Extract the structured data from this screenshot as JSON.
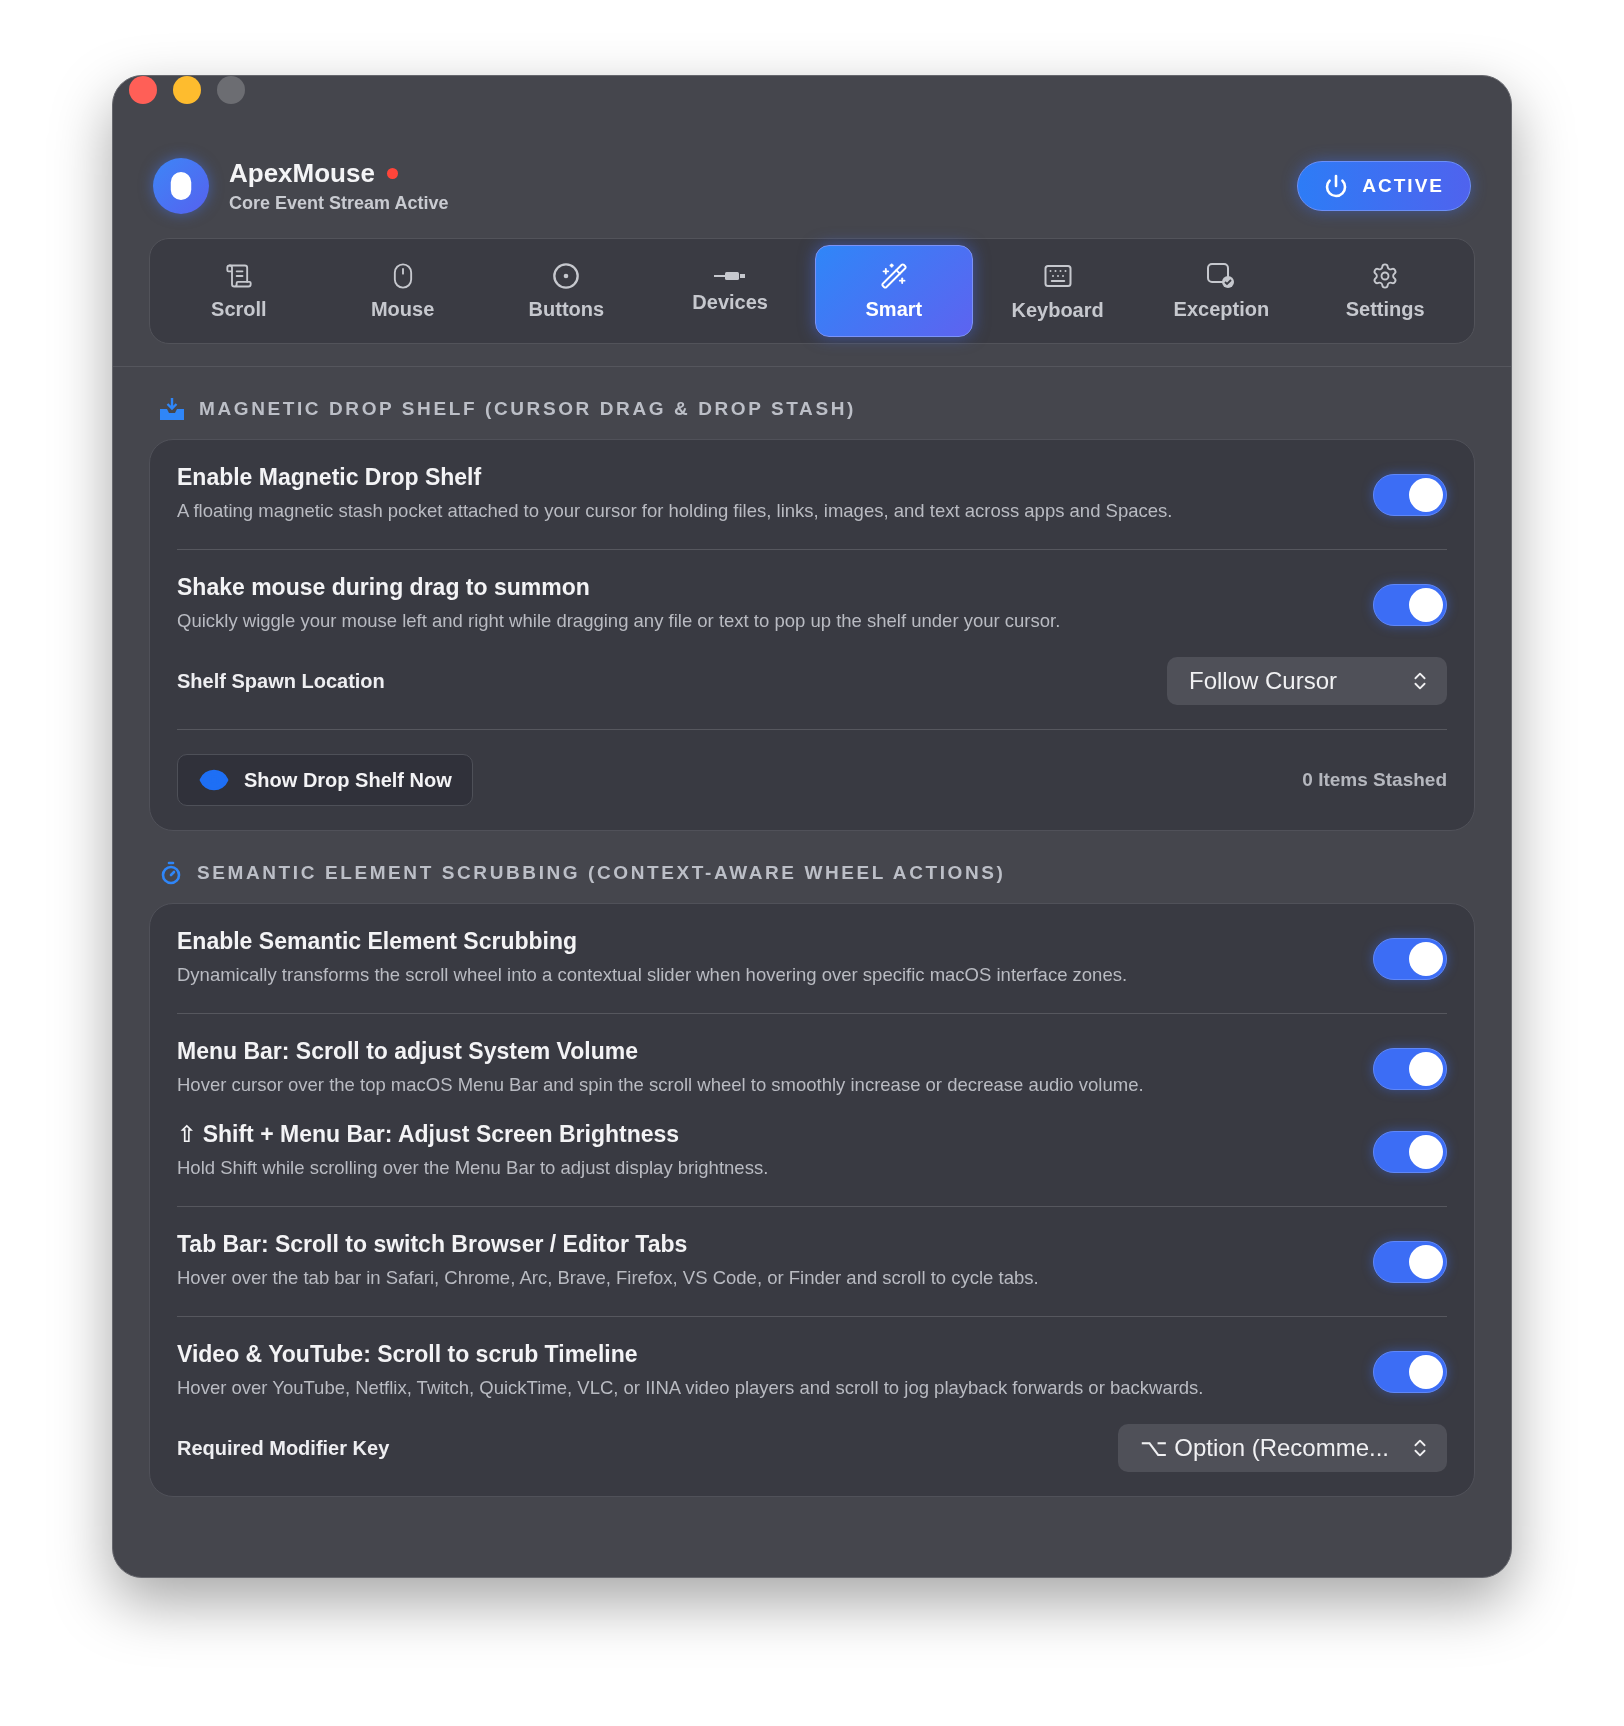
{
  "window": {
    "controls": [
      {
        "color": "#ff5f57"
      },
      {
        "color": "#febc2e"
      },
      {
        "color": "#6c6d72"
      }
    ]
  },
  "header": {
    "app_name": "ApexMouse",
    "status_dot": {
      "color": "#ff453a"
    },
    "subtitle": "Core Event Stream Active",
    "power_button": {
      "label": "ACTIVE"
    }
  },
  "tabs": [
    {
      "label": "Scroll",
      "selected": false
    },
    {
      "label": "Mouse",
      "selected": false
    },
    {
      "label": "Buttons",
      "selected": false
    },
    {
      "label": "Devices",
      "selected": false
    },
    {
      "label": "Smart",
      "selected": true
    },
    {
      "label": "Keyboard",
      "selected": false
    },
    {
      "label": "Exception",
      "selected": false
    },
    {
      "label": "Settings",
      "selected": false
    }
  ],
  "sections": [
    {
      "kind": "shelf",
      "title": "MAGNETIC DROP SHELF (CURSOR DRAG & DROP STASH)",
      "groups": [
        [
          {
            "kind": "toggle",
            "title": "Enable Magnetic Drop Shelf",
            "description": "A floating magnetic stash pocket attached to your cursor for holding files, links, images, and text across apps and Spaces.",
            "on": true
          }
        ],
        [
          {
            "kind": "toggle",
            "title": "Shake mouse during drag to summon",
            "description": "Quickly wiggle your mouse left and right while dragging any file or text to pop up the shelf under your cursor.",
            "on": true
          },
          {
            "kind": "select",
            "label": "Shelf Spawn Location",
            "value": "Follow Cursor"
          }
        ],
        [
          {
            "kind": "action",
            "button": "Show Drop Shelf Now",
            "count": "0 Items Stashed"
          }
        ]
      ]
    },
    {
      "kind": "scrub",
      "title": "SEMANTIC ELEMENT SCRUBBING (CONTEXT-AWARE WHEEL ACTIONS)",
      "groups": [
        [
          {
            "kind": "toggle",
            "title": "Enable Semantic Element Scrubbing",
            "description": "Dynamically transforms the scroll wheel into a contextual slider when hovering over specific macOS interface zones.",
            "on": true
          }
        ],
        [
          {
            "kind": "toggle",
            "title": "Menu Bar: Scroll to adjust System Volume",
            "description": "Hover cursor over the top macOS Menu Bar and spin the scroll wheel to smoothly increase or decrease audio volume.",
            "on": true
          },
          {
            "kind": "toggle",
            "title": "⇧ Shift + Menu Bar: Adjust Screen Brightness",
            "description": "Hold Shift while scrolling over the Menu Bar to adjust display brightness.",
            "on": true
          }
        ],
        [
          {
            "kind": "toggle",
            "title": "Tab Bar: Scroll to switch Browser / Editor Tabs",
            "description": "Hover over the tab bar in Safari, Chrome, Arc, Brave, Firefox, VS Code, or Finder and scroll to cycle tabs.",
            "on": true
          }
        ],
        [
          {
            "kind": "toggle",
            "title": "Video & YouTube: Scroll to scrub Timeline",
            "description": "Hover over YouTube, Netflix, Twitch, QuickTime, VLC, or IINA video players and scroll to jog playback forwards or backwards.",
            "on": true
          },
          {
            "kind": "select",
            "label": "Required Modifier Key",
            "value": "⌥ Option (Recomme..."
          }
        ]
      ]
    }
  ]
}
